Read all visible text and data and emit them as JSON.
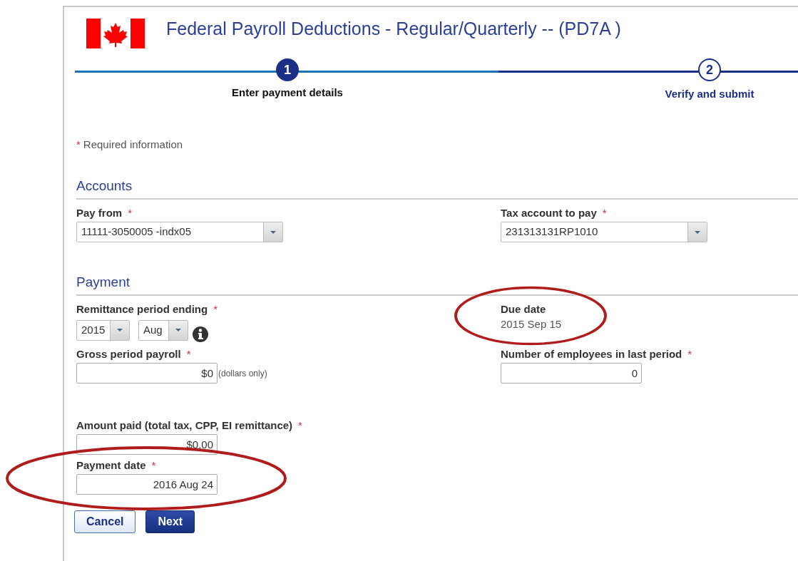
{
  "header": {
    "title": "Federal Payroll Deductions - Regular/Quarterly -- (PD7A )"
  },
  "steps": [
    {
      "number": "1",
      "label": "Enter payment details",
      "selected": true
    },
    {
      "number": "2",
      "label": "Verify and submit",
      "selected": false
    }
  ],
  "required_note": {
    "mark": "*",
    "text": "Required information"
  },
  "accounts": {
    "heading": "Accounts",
    "pay_from": {
      "label": "Pay from",
      "required_mark": "*",
      "value": "11111-3050005 -indx05"
    },
    "tax_account": {
      "label": "Tax account to pay",
      "required_mark": "*",
      "value": "231313131RP1010"
    }
  },
  "payment": {
    "heading": "Payment",
    "remittance": {
      "label": "Remittance period ending",
      "required_mark": "*",
      "year": "2015",
      "month": "Aug"
    },
    "due_date": {
      "label": "Due date",
      "value": "2015 Sep 15",
      "circled": true
    },
    "gross": {
      "label": "Gross period payroll",
      "required_mark": "*",
      "value": "$0",
      "hint": "(dollars only)"
    },
    "employees": {
      "label": "Number of employees in last period",
      "required_mark": "*",
      "value": "0"
    },
    "amount": {
      "label": "Amount paid (total tax, CPP, EI remittance)",
      "required_mark": "*",
      "value": "$0.00"
    },
    "payment_date": {
      "label": "Payment date",
      "required_mark": "*",
      "value": "2016 Aug 24",
      "circled": true
    }
  },
  "buttons": [
    {
      "label": "Cancel",
      "kind": "secondary"
    },
    {
      "label": "Next",
      "kind": "primary"
    }
  ]
}
